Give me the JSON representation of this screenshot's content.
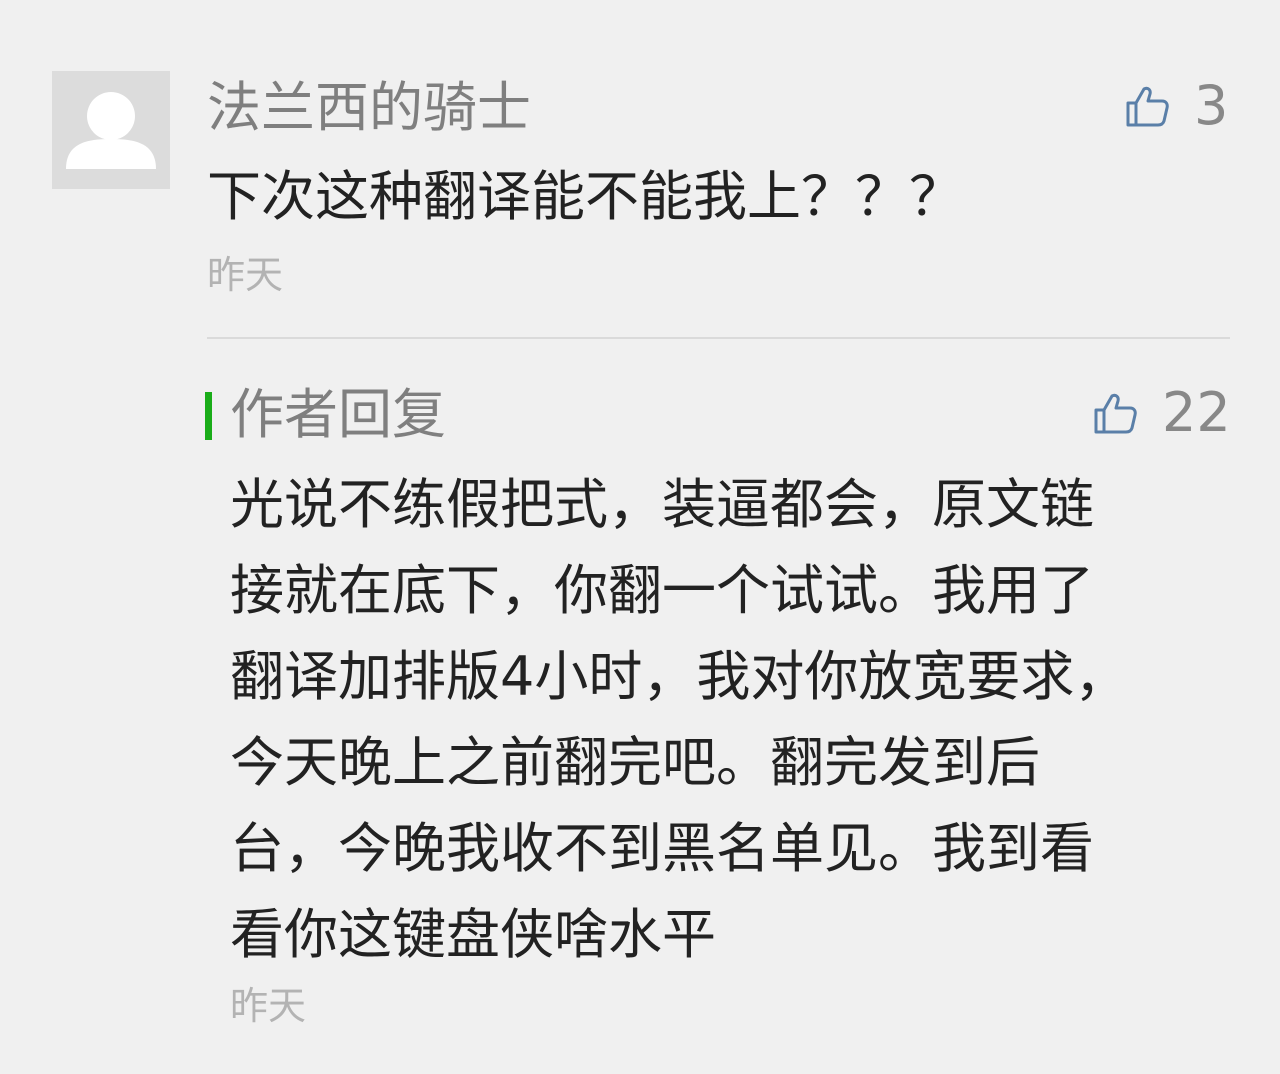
{
  "comment": {
    "username": "法兰西的骑士",
    "text": "下次这种翻译能不能我上？？？",
    "likes": "3",
    "time": "昨天"
  },
  "reply": {
    "label": "作者回复",
    "likes": "22",
    "text": "光说不练假把式，装逼都会，原文链\n接就在底下，你翻一个试试。我用了\n翻译加排版4小时，我对你放宽要求，\n今天晚上之前翻完吧。翻完发到后\n台，今晚我收不到黑名单见。我到看\n看你这键盘侠啥水平",
    "time": "昨天"
  },
  "colors": {
    "background": "#f0f0f0",
    "reply_accent": "#1aad19",
    "muted_text": "#7f7f7f",
    "main_text": "#222222"
  },
  "icons": {
    "avatar": "default-user-avatar-icon",
    "like": "thumbs-up-icon"
  }
}
